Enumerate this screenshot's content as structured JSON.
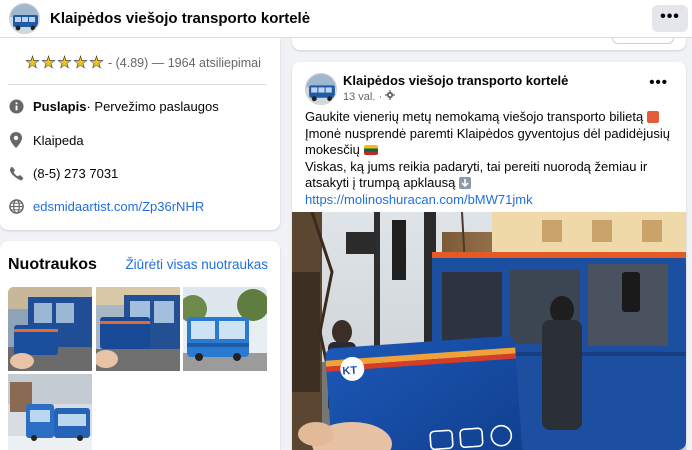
{
  "header": {
    "title": "Klaipėdos viešojo transporto kortelė",
    "more_label": "•••"
  },
  "intro": {
    "rating_text": "- (4.89) — 1964 atsiliepimai",
    "rating_value": 4.89,
    "page_type_bold": "Puslapis",
    "page_type_rest": " · Pervežimo paslaugos",
    "city": "Klaipeda",
    "phone": "(8-5) 273 7031",
    "website": "edsmidaartist.com/Zp36rNHR"
  },
  "photos": {
    "title": "Nuotraukos",
    "see_all": "Žiūrėti visas nuotraukas"
  },
  "post": {
    "author": "Klaipėdos viešojo transporto kortelė",
    "time": "13 val. ·",
    "more_label": "•••",
    "line1": "Gaukite vienerių metų nemokamą viešojo transporto bilietą",
    "line2": "Įmonė nusprendė paremti Klaipėdos gyventojus dėl padidėjusių mokesčių",
    "line3": "Viskas, ką jums reikia padaryti, tai pereiti nuorodą žemiau ir atsakyti į trumpą apklausą",
    "link": "https://molinoshuracan.com/bMW71jmk",
    "card_logo": "KT"
  },
  "colors": {
    "link": "#216fdb",
    "bus_blue": "#1c4fa0",
    "star": "#f5c518"
  }
}
